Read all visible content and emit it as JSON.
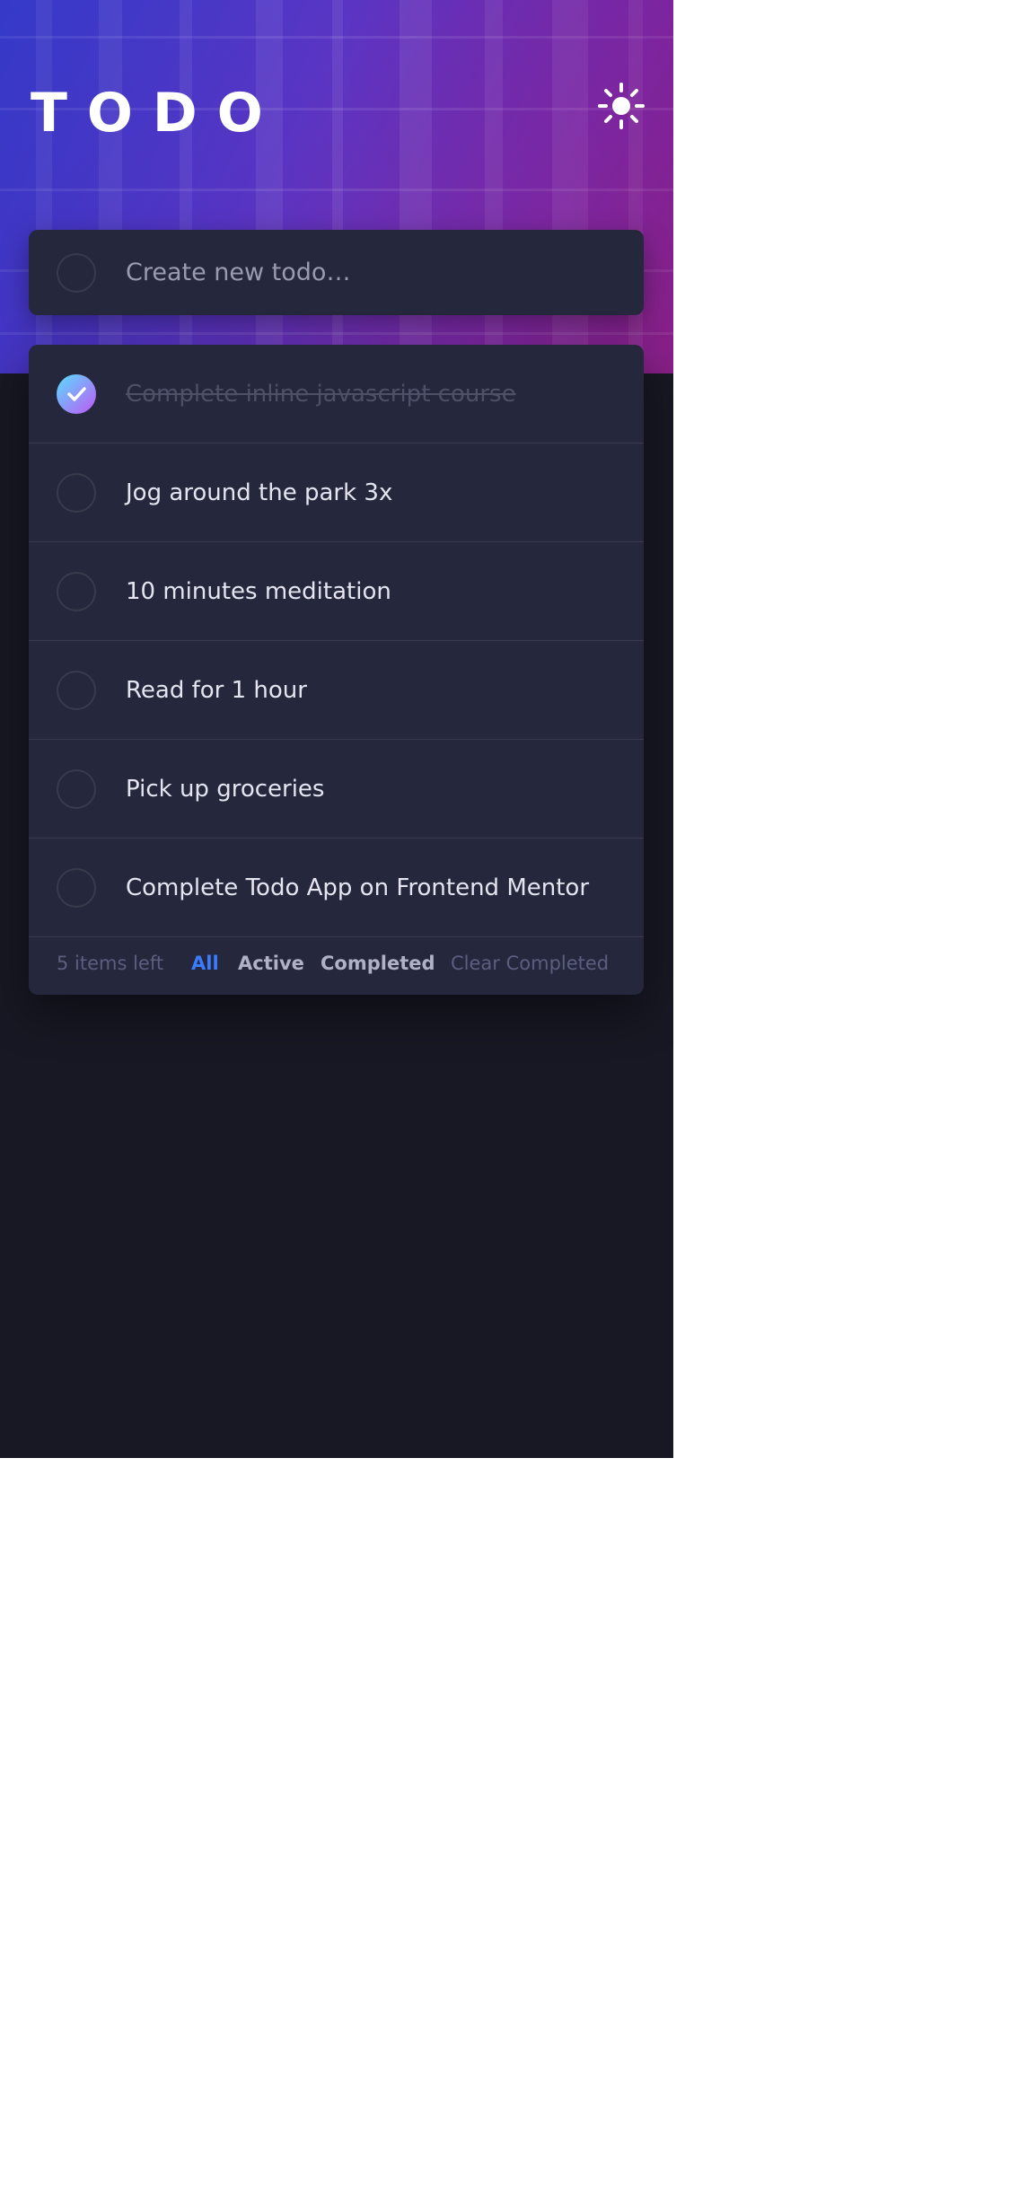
{
  "app": {
    "title": "TODO",
    "theme_toggle_icon": "sun-icon"
  },
  "new_todo": {
    "placeholder": "Create new todo…",
    "value": ""
  },
  "todos": [
    {
      "text": "Complete inline javascript course",
      "completed": true
    },
    {
      "text": "Jog around the park 3x",
      "completed": false
    },
    {
      "text": "10 minutes meditation",
      "completed": false
    },
    {
      "text": "Read for 1 hour",
      "completed": false
    },
    {
      "text": "Pick up groceries",
      "completed": false
    },
    {
      "text": "Complete Todo App on Frontend Mentor",
      "completed": false
    }
  ],
  "footer": {
    "items_left": "5 items left",
    "filters": {
      "all": "All",
      "active": "Active",
      "completed": "Completed"
    },
    "active_filter": "All",
    "clear_completed": "Clear Completed"
  },
  "colors": {
    "background": "#181824",
    "card": "#25273d",
    "divider": "#393a4c",
    "accent_blue": "#3a7cfd",
    "check_gradient_start": "#57ddff",
    "check_gradient_end": "#c058f3",
    "text_primary": "#e4e5f1",
    "text_muted": "#5b5e7e"
  }
}
